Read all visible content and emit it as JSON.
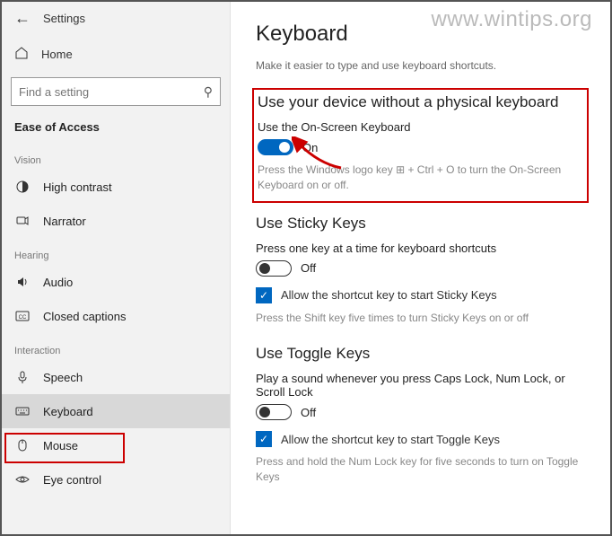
{
  "watermark": "www.wintips.org",
  "window": {
    "title": "Settings"
  },
  "sidebar": {
    "home": "Home",
    "search_placeholder": "Find a setting",
    "category": "Ease of Access",
    "groups": [
      {
        "label": "Vision",
        "items": [
          {
            "key": "high-contrast",
            "label": "High contrast"
          },
          {
            "key": "narrator",
            "label": "Narrator"
          }
        ]
      },
      {
        "label": "Hearing",
        "items": [
          {
            "key": "audio",
            "label": "Audio"
          },
          {
            "key": "closed-captions",
            "label": "Closed captions"
          }
        ]
      },
      {
        "label": "Interaction",
        "items": [
          {
            "key": "speech",
            "label": "Speech"
          },
          {
            "key": "keyboard",
            "label": "Keyboard",
            "selected": true
          },
          {
            "key": "mouse",
            "label": "Mouse"
          },
          {
            "key": "eye-control",
            "label": "Eye control"
          }
        ]
      }
    ]
  },
  "main": {
    "title": "Keyboard",
    "subtitle": "Make it easier to type and use keyboard shortcuts.",
    "sections": {
      "osk": {
        "heading": "Use your device without a physical keyboard",
        "label": "Use the On-Screen Keyboard",
        "state": "On",
        "hint": "Press the Windows logo key ⊞ + Ctrl + O to turn the On-Screen Keyboard on or off."
      },
      "sticky": {
        "heading": "Use Sticky Keys",
        "label": "Press one key at a time for keyboard shortcuts",
        "state": "Off",
        "checkbox": "Allow the shortcut key to start Sticky Keys",
        "hint": "Press the Shift key five times to turn Sticky Keys on or off"
      },
      "toggle": {
        "heading": "Use Toggle Keys",
        "label": "Play a sound whenever you press Caps Lock, Num Lock, or Scroll Lock",
        "state": "Off",
        "checkbox": "Allow the shortcut key to start Toggle Keys",
        "hint": "Press and hold the Num Lock key for five seconds to turn on Toggle Keys"
      }
    }
  }
}
